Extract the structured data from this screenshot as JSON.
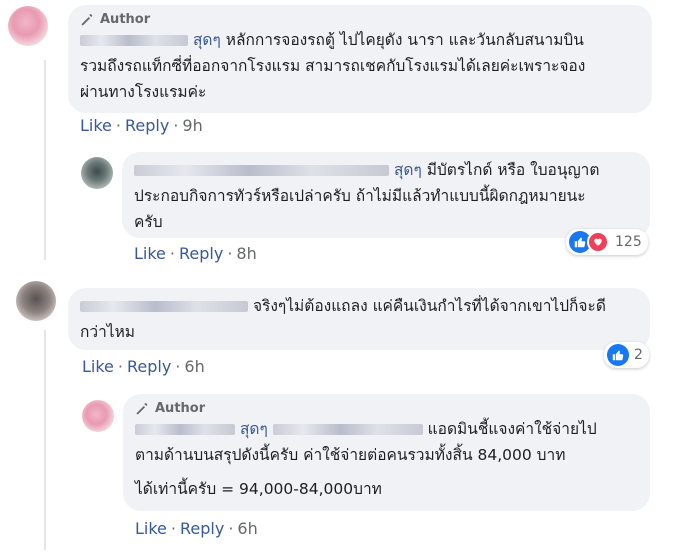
{
  "comments": [
    {
      "author_badge": "Author",
      "name_suffix": "สุดๆ",
      "text_lines": [
        "หลักการจองรถตู้ ไปไคยุดัง นารา และวันกลับสนามบิน",
        "รวมถึงรถแท็กซี่ที่ออกจากโรงแรม สามารถเชคกับโรงแรมได้เลยค่ะเพราะจอง",
        "ผ่านทางโรงแรมค่ะ"
      ],
      "like": "Like",
      "reply": "Reply",
      "time": "9h"
    },
    {
      "name_suffix": "สุดๆ",
      "text_lines": [
        "มีบัตรไกด์ หรือ ใบอนุญาต",
        "ประกอบกิจการทัวร์หรือเปล่าครับ ถ้าไม่มีแล้วทำแบบนี้ผิดกฎหมายนะ",
        "ครับ"
      ],
      "like": "Like",
      "reply": "Reply",
      "time": "8h",
      "reaction_count": "125"
    },
    {
      "text_lines": [
        "จริงๆไม่ต้องแถลง แค่คืนเงินกำไรที่ได้จากเขาไปก็จะดี",
        "กว่าไหม"
      ],
      "like": "Like",
      "reply": "Reply",
      "time": "6h",
      "reaction_count": "2"
    },
    {
      "author_badge": "Author",
      "name_suffix": "สุดๆ",
      "text_lines": [
        "แอดมินชี้แจงค่าใช้จ่ายไป",
        "ตามด้านบนสรุปดังนี้ครับ ค่าใช้จ่ายต่อคนรวมทั้งสิ้น 84,000 บาท",
        "ได้เท่านี้ครับ = 94,000-84,000บาท"
      ],
      "like": "Like",
      "reply": "Reply",
      "time": "6h"
    }
  ],
  "colors": {
    "link": "#385898",
    "bubble": "#f0f2f5",
    "meta": "#65676b",
    "like_blue": "#1877f2",
    "love_red": "#f33e58"
  },
  "icons": [
    "pen-icon",
    "like-reaction-icon",
    "love-reaction-icon"
  ]
}
